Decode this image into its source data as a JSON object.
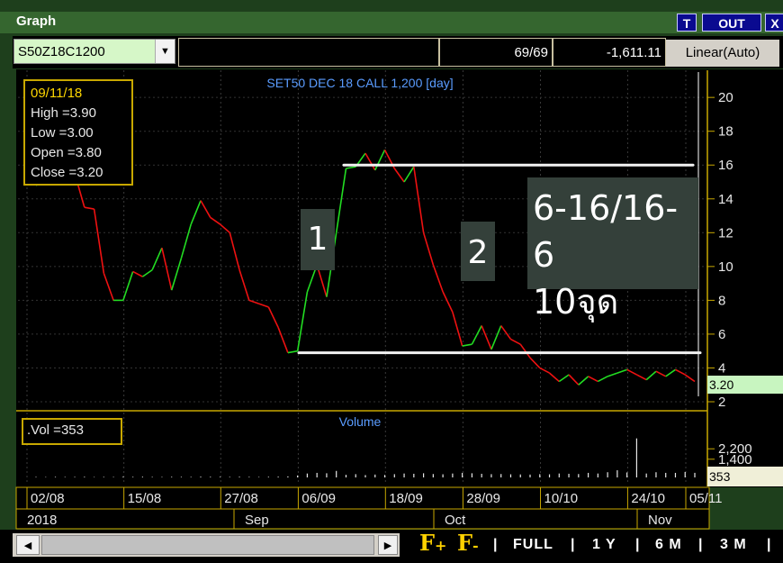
{
  "window": {
    "title": "Graph",
    "buttons": [
      "T",
      "OUT",
      "X"
    ]
  },
  "toolbar": {
    "symbol": "S50Z18C1200",
    "count": "69/69",
    "change": "-1,611.11",
    "scale": "Linear(Auto)"
  },
  "info": {
    "date": "09/11/18",
    "high": "High  =3.90",
    "low": "Low   =3.00",
    "open": "Open  =3.80",
    "close": "Close  =3.20"
  },
  "vol_label": ".Vol  =353",
  "annotations": {
    "label1": "1",
    "label2": "2",
    "box_line1": "6-16/16-6",
    "box_line2": "10จุด"
  },
  "badges": {
    "price": "3.20",
    "volume": "353"
  },
  "nav": {
    "full": "FULL",
    "y1": "1 Y",
    "m6": "6 M",
    "m3": "3 M",
    "sep": "|"
  },
  "colors": {
    "up": "#22dd22",
    "down": "#ee1111",
    "title": "#5a9cff",
    "annotation_line": "#f2f2f2"
  },
  "chart_data": [
    {
      "type": "line",
      "title": "SET50 DEC 18 CALL 1,200 [day]",
      "ylim": [
        2,
        21.5
      ],
      "yticks": [
        2,
        4,
        6,
        8,
        10,
        12,
        14,
        16,
        18,
        20
      ],
      "x_tick_labels": [
        "02/08",
        "15/08",
        "27/08",
        "06/09",
        "18/09",
        "28/09",
        "10/10",
        "24/10",
        "05/11"
      ],
      "period_labels": [
        "2018",
        "Sep",
        "Oct",
        "Nov"
      ],
      "series": [
        {
          "values": [
            14.8,
            15.0,
            15.4,
            15.6,
            15.5,
            13.5,
            13.4,
            9.6,
            8.0,
            8.0,
            9.7,
            9.4,
            9.8,
            11.1,
            8.6,
            10.5,
            12.5,
            13.9,
            12.9,
            12.5,
            12.0,
            9.8,
            8.0,
            7.8,
            7.6,
            6.4,
            4.9,
            5.0,
            8.5,
            10.1,
            8.2,
            12.0,
            15.8,
            15.9,
            16.7,
            15.7,
            16.9,
            15.8,
            15.0,
            15.9,
            12.0,
            10.1,
            8.5,
            7.3,
            5.3,
            5.4,
            6.5,
            5.1,
            6.5,
            5.7,
            5.4,
            4.6,
            4.0,
            3.7,
            3.2,
            3.6,
            3.0,
            3.5,
            3.2,
            3.5,
            3.7,
            3.9,
            3.6,
            3.3,
            3.8,
            3.5,
            3.9,
            3.6,
            3.2
          ]
        }
      ],
      "annotation_levels": [
        16,
        4.9
      ]
    },
    {
      "type": "bar",
      "title": "Volume",
      "yticks": [
        1400,
        2200
      ],
      "ylim": [
        0,
        3600
      ],
      "values": [
        40,
        30,
        45,
        35,
        40,
        50,
        30,
        40,
        35,
        60,
        45,
        55,
        40,
        35,
        50,
        45,
        40,
        60,
        50,
        45,
        40,
        55,
        45,
        35,
        50,
        60,
        80,
        150,
        300,
        350,
        320,
        500,
        200,
        250,
        180,
        220,
        190,
        250,
        300,
        280,
        320,
        260,
        240,
        300,
        350,
        320,
        280,
        250,
        260,
        240,
        230,
        220,
        250,
        240,
        300,
        280,
        260,
        350,
        300,
        400,
        550,
        380,
        3000,
        300,
        400,
        350,
        350,
        420,
        353
      ]
    }
  ]
}
